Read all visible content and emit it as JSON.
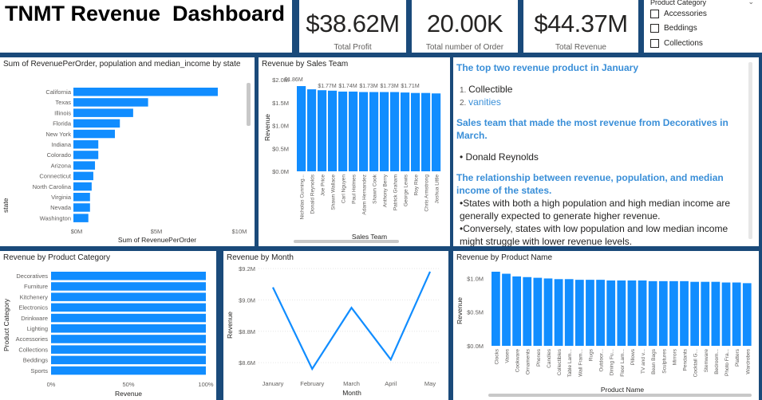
{
  "title": "TNMT Revenue  Dashboard",
  "cards": [
    {
      "value": "$38.62M",
      "label": "Total Profit"
    },
    {
      "value": "20.00K",
      "label": "Total number of Order"
    },
    {
      "value": "$44.37M",
      "label": "Total Revenue"
    }
  ],
  "slicer": {
    "header": "Product Category",
    "options": [
      "Accessories",
      "Beddings",
      "Collections"
    ]
  },
  "state_chart": {
    "title": "Sum of RevenuePerOrder, population and median_income by state",
    "chart_data": {
      "type": "bar",
      "orientation": "horizontal",
      "categories": [
        "California",
        "Texas",
        "Illinois",
        "Florida",
        "New York",
        "Indiana",
        "Colorado",
        "Arizona",
        "Connecticut",
        "North Carolina",
        "Virginia",
        "Nevada",
        "Washington"
      ],
      "values": [
        8.7,
        4.5,
        3.6,
        2.8,
        2.5,
        1.5,
        1.5,
        1.3,
        1.2,
        1.1,
        1.0,
        1.0,
        0.9
      ],
      "xlim": [
        0,
        10
      ],
      "xticks": [
        "$0M",
        "$5M",
        "$10M"
      ],
      "xlabel": "Sum of RevenuePerOrder",
      "ylabel": "state",
      "color": "#118DFF"
    }
  },
  "team_chart": {
    "title": "Revenue by Sales Team",
    "chart_data": {
      "type": "bar",
      "categories": [
        "Nicholas Cunning...",
        "Donald Reynolds",
        "Joe Price",
        "Shawn Wallace",
        "Carl Nguyen",
        "Paul Holmes",
        "Adam Hernandez",
        "Shawn Cook",
        "Anthony Berry",
        "Patrick Graham",
        "George Lewis",
        "Roy Rice",
        "Chris Armstrong",
        "Joshua Little"
      ],
      "values": [
        1.86,
        1.79,
        1.77,
        1.76,
        1.74,
        1.74,
        1.73,
        1.73,
        1.73,
        1.73,
        1.72,
        1.71,
        1.71,
        1.7
      ],
      "data_labels": [
        "$1.86M",
        "",
        "$1.77M",
        "",
        "$1.74M",
        "",
        "$1.73M",
        "",
        "$1.73M",
        "",
        "$1.71M",
        "",
        "",
        ""
      ],
      "ylim": [
        0,
        2.0
      ],
      "yticks": [
        "$0.0M",
        "$0.5M",
        "$1.0M",
        "$1.5M",
        "$2.0M"
      ],
      "xlabel": "Sales Team",
      "ylabel": "Revenue",
      "color": "#118DFF"
    }
  },
  "text_box": {
    "h1": "The top two revenue product in January",
    "list_items": [
      "Collectible",
      "vanities"
    ],
    "h2": "Sales team that made the most revenue from Decoratives in March.",
    "bullet1": "Donald Reynolds",
    "h3": "The relationship between revenue, population, and median income of the states.",
    "bullet2": "States with both a high population and high median income are generally expected to generate higher revenue.",
    "bullet3": "Conversely, states with low population and low median income might struggle with lower revenue levels."
  },
  "category_chart": {
    "title": "Revenue by Product Category",
    "chart_data": {
      "type": "bar",
      "orientation": "horizontal",
      "categories": [
        "Decoratives",
        "Furniture",
        "Kitchenery",
        "Electronics",
        "Drinkware",
        "Lighting",
        "Accessories",
        "Collections",
        "Beddings",
        "Sports"
      ],
      "values": [
        100,
        100,
        100,
        100,
        100,
        100,
        100,
        100,
        100,
        100
      ],
      "xlim": [
        0,
        100
      ],
      "xticks": [
        "0%",
        "50%",
        "100%"
      ],
      "xlabel": "Revenue",
      "ylabel": "Product Category",
      "color": "#118DFF"
    }
  },
  "month_chart": {
    "title": "Revenue by Month",
    "chart_data": {
      "type": "line",
      "categories": [
        "January",
        "February",
        "March",
        "April",
        "May"
      ],
      "values": [
        9.08,
        8.56,
        8.95,
        8.62,
        9.18
      ],
      "ylim": [
        8.55,
        9.2
      ],
      "yticks": [
        {
          "v": 8.6,
          "t": "$8.6M"
        },
        {
          "v": 8.8,
          "t": "$8.8M"
        },
        {
          "v": 9.0,
          "t": "$9.0M"
        },
        {
          "v": 9.2,
          "t": "$9.2M"
        }
      ],
      "xlabel": "Month",
      "ylabel": "Revenue",
      "color": "#118DFF"
    }
  },
  "product_chart": {
    "title": "Revenue by Product Name",
    "chart_data": {
      "type": "bar",
      "categories": [
        "Clocks",
        "Vases",
        "Cookware",
        "Ornaments",
        "Phones",
        "Candles",
        "Collectibles",
        "Table Lam...",
        "Wall Fram...",
        "Rugs",
        "Outdoor...",
        "Dining Fu...",
        "Floor Lam...",
        "Pillows",
        "TV and v...",
        "Bean Bags",
        "Sculptures",
        "Mirrors",
        "Pendants",
        "Cocktail G...",
        "Stemware",
        "Bedroom...",
        "Photo Fra...",
        "Platters",
        "Wardrobes"
      ],
      "values": [
        1.1,
        1.07,
        1.03,
        1.02,
        1.01,
        1.0,
        0.99,
        0.99,
        0.98,
        0.98,
        0.98,
        0.97,
        0.97,
        0.97,
        0.97,
        0.96,
        0.96,
        0.96,
        0.96,
        0.95,
        0.95,
        0.95,
        0.94,
        0.94,
        0.93
      ],
      "ylim": [
        0,
        1.1
      ],
      "yticks": [
        {
          "v": 0,
          "t": "$0.0M"
        },
        {
          "v": 0.5,
          "t": "$0.5M"
        },
        {
          "v": 1.0,
          "t": "$1.0M"
        }
      ],
      "xlabel": "Product Name",
      "ylabel": "Revenue",
      "color": "#118DFF"
    }
  }
}
